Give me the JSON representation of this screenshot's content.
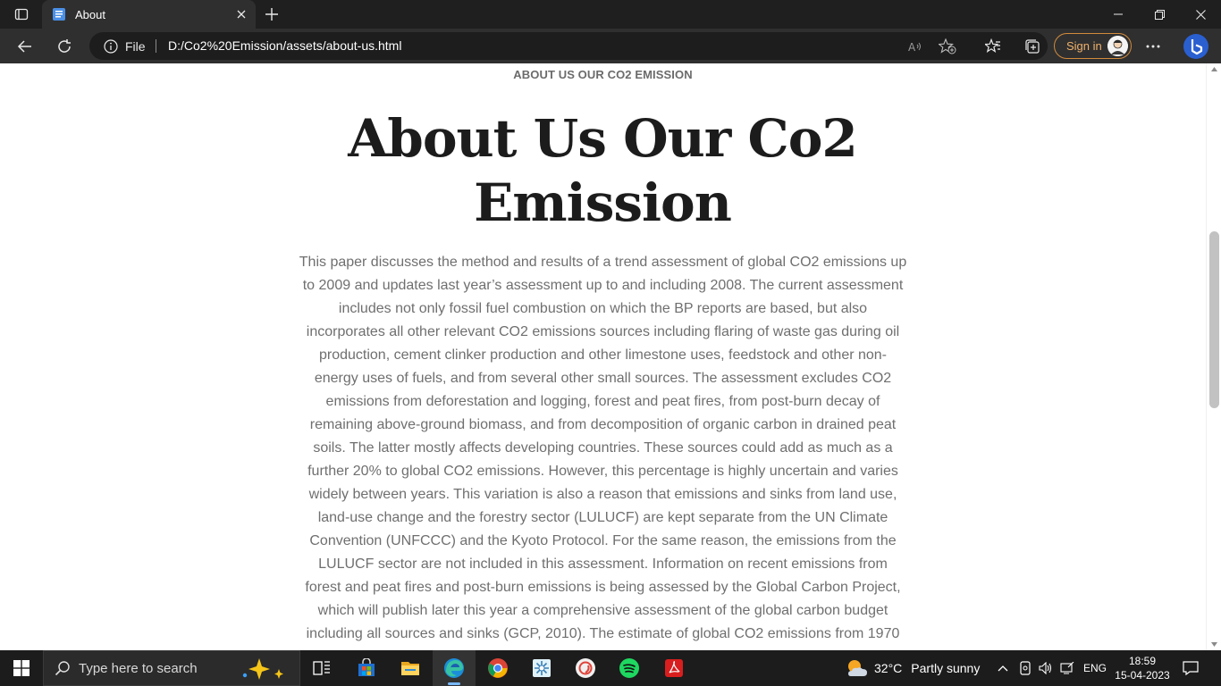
{
  "browser": {
    "tab": {
      "title": "About"
    },
    "address_bar": {
      "site_info_label": "File",
      "url": "D:/Co2%20Emission/assets/about-us.html"
    },
    "signin_label": "Sign in",
    "colors": {
      "accent": "#d08a3c",
      "bing": "#2f7be6"
    }
  },
  "page": {
    "eyebrow": "ABOUT US OUR CO2 EMISSION",
    "heading_line1": "About Us Our Co2",
    "heading_line2": "Emission",
    "body": "This paper discusses the method and results of a trend assessment of global CO2 emissions up to 2009 and updates last year’s assessment up to and including 2008. The current assessment includes not only fossil fuel combustion on which the BP reports are based, but also incorporates all other relevant CO2 emissions sources including flaring of waste gas during oil production, cement clinker production and other limestone uses, feedstock and other non-energy uses of fuels, and from several other small sources. The assessment excludes CO2 emissions from deforestation and logging, forest and peat fires, from post-burn decay of remaining above-ground biomass, and from decomposition of organic carbon in drained peat soils. The latter mostly affects developing countries. These sources could add as much as a further 20% to global CO2 emissions. However, this percentage is highly uncertain and varies widely between years. This variation is also a reason that emissions and sinks from land use, land-use change and the forestry sector (LULUCF) are kept separate from the UN Climate Convention (UNFCCC) and the Kyoto Protocol. For the same reason, the emissions from the LULUCF sector are not included in this assessment. Information on recent emissions from forest and peat fires and post-burn emissions is being assessed by the Global Carbon Project, which will publish later this year a comprehensive assessment of the global carbon budget including all sources and sinks (GCP, 2010). The estimate of global CO2 emissions from 1970"
  },
  "taskbar": {
    "search_placeholder": "Type here to search",
    "apps": [
      "task-view",
      "microsoft-store",
      "file-explorer",
      "edge",
      "chrome",
      "snip-sketch",
      "app-circle",
      "spotify",
      "acrobat"
    ],
    "weather": {
      "temp": "32°C",
      "condition": "Partly sunny"
    },
    "language": "ENG",
    "time": "18:59",
    "date": "15-04-2023"
  }
}
